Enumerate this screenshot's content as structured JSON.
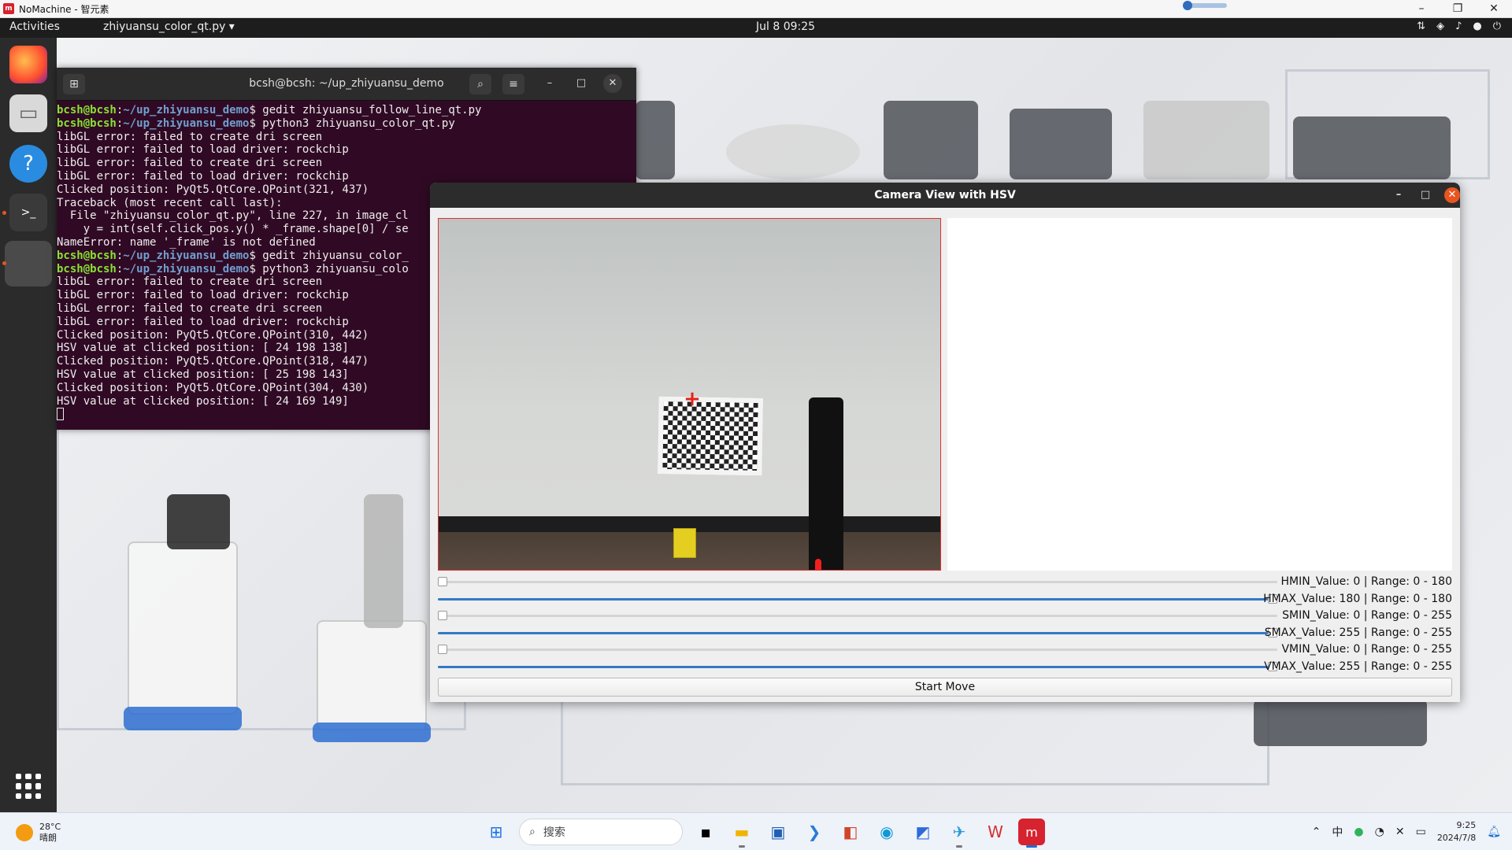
{
  "window": {
    "title": "NoMachine - 智元素",
    "logo": "m",
    "minimize": "–",
    "restore": "❐",
    "close": "✕"
  },
  "gnome": {
    "activities": "Activities",
    "app_menu": "zhiyuansu_color_qt.py ▾",
    "clock": "Jul 8  09:25",
    "tray_icons": [
      "network-icon",
      "wifi-icon",
      "volume-icon",
      "mic-icon",
      "power-icon"
    ]
  },
  "dock": {
    "items": [
      "firefox-icon",
      "files-icon",
      "help-icon",
      "terminal-icon",
      "app-placeholder-icon"
    ],
    "grid": "show-apps-icon"
  },
  "terminal": {
    "title": "bcsh@bcsh: ~/up_zhiyuansu_demo",
    "lines": [
      {
        "user": "bcsh@bcsh",
        "path": "~/up_zhiyuansu_demo",
        "cmd": "$ gedit zhiyuansu_follow_line_qt.py"
      },
      {
        "user": "bcsh@bcsh",
        "path": "~/up_zhiyuansu_demo",
        "cmd": "$ python3 zhiyuansu_color_qt.py"
      },
      {
        "text": "libGL error: failed to create dri screen"
      },
      {
        "text": "libGL error: failed to load driver: rockchip"
      },
      {
        "text": "libGL error: failed to create dri screen"
      },
      {
        "text": "libGL error: failed to load driver: rockchip"
      },
      {
        "text": "Clicked position: PyQt5.QtCore.QPoint(321, 437)"
      },
      {
        "text": "Traceback (most recent call last):"
      },
      {
        "text": "  File \"zhiyuansu_color_qt.py\", line 227, in image_cl"
      },
      {
        "text": "    y = int(self.click_pos.y() * _frame.shape[0] / se"
      },
      {
        "text": "NameError: name '_frame' is not defined"
      },
      {
        "user": "bcsh@bcsh",
        "path": "~/up_zhiyuansu_demo",
        "cmd": "$ gedit zhiyuansu_color_"
      },
      {
        "user": "bcsh@bcsh",
        "path": "~/up_zhiyuansu_demo",
        "cmd": "$ python3 zhiyuansu_colo"
      },
      {
        "text": "libGL error: failed to create dri screen"
      },
      {
        "text": "libGL error: failed to load driver: rockchip"
      },
      {
        "text": "libGL error: failed to create dri screen"
      },
      {
        "text": "libGL error: failed to load driver: rockchip"
      },
      {
        "text": "Clicked position: PyQt5.QtCore.QPoint(310, 442)"
      },
      {
        "text": "HSV value at clicked position: [ 24 198 138]"
      },
      {
        "text": "Clicked position: PyQt5.QtCore.QPoint(318, 447)"
      },
      {
        "text": "HSV value at clicked position: [ 25 198 143]"
      },
      {
        "text": "Clicked position: PyQt5.QtCore.QPoint(304, 430)"
      },
      {
        "text": "HSV value at clicked position: [ 24 169 149]"
      }
    ]
  },
  "camera": {
    "title": "Camera View with HSV",
    "crosshair": "+",
    "sliders": [
      {
        "label": "HMIN_Value: 0 | Range: 0 - 180",
        "value": 0,
        "max": 180
      },
      {
        "label": "HMAX_Value: 180 | Range: 0 - 180",
        "value": 180,
        "max": 180
      },
      {
        "label": "SMIN_Value: 0 | Range: 0 - 255",
        "value": 0,
        "max": 255
      },
      {
        "label": "SMAX_Value: 255 | Range: 0 - 255",
        "value": 255,
        "max": 255
      },
      {
        "label": "VMIN_Value: 0 | Range: 0 - 255",
        "value": 0,
        "max": 255
      },
      {
        "label": "VMAX_Value: 255 | Range: 0 - 255",
        "value": 255,
        "max": 255
      }
    ],
    "start_button": "Start Move"
  },
  "taskbar": {
    "weather": {
      "temp": "28°C",
      "cond": "晴朗"
    },
    "search_placeholder": "搜索",
    "ime": "中",
    "time": "9:25",
    "date": "2024/7/8"
  }
}
